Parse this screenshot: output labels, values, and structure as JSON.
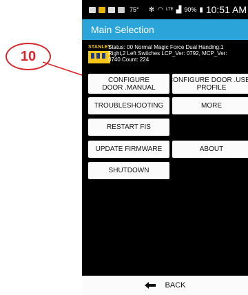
{
  "callout": {
    "number": "10"
  },
  "statusbar": {
    "temp": "75°",
    "signal_label": "LTE",
    "battery": "90%",
    "time": "10:51 AM"
  },
  "title": "Main Selection",
  "info": {
    "brand": "STANLEY",
    "line1": "Status: 00 Normal Magic Force Dual Handing:1",
    "line2": "Right,2 Left Switches LCP_Ver: 0792, MCP_Ver:",
    "line3": "0740 Count: 224"
  },
  "buttons": {
    "configure_manual": {
      "line1": "CONFIGURE",
      "line2": "DOOR .MANUAL"
    },
    "configure_used": {
      "line1": "CONFIGURE DOOR .USED",
      "line2": "PROFILE"
    },
    "troubleshooting": "TROUBLESHOOTING",
    "more": "MORE",
    "restart": "RESTART FIS",
    "update_firmware": "UPDATE FIRMWARE",
    "about": "ABOUT",
    "shutdown": "SHUTDOWN"
  },
  "back": {
    "label": "BACK",
    "icon": "arrow-left-icon"
  },
  "colors": {
    "accent": "#2aa4d9",
    "callout": "#d9262b",
    "logo": "#f5c518"
  }
}
